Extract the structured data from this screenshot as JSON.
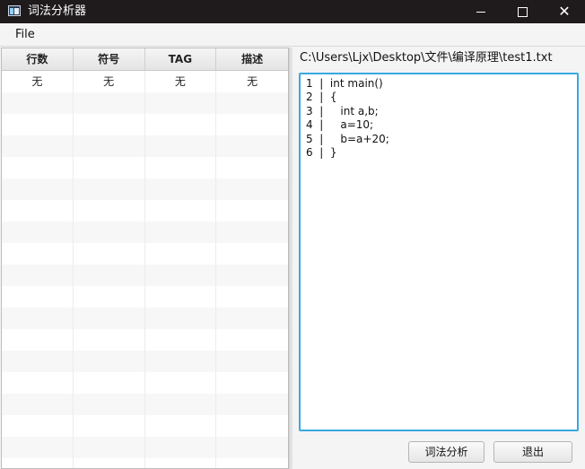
{
  "window": {
    "title": "词法分析器",
    "controls": {
      "minimize": "minimize-icon",
      "maximize": "maximize-icon",
      "close": "close-icon"
    }
  },
  "menubar": {
    "file": "File"
  },
  "table": {
    "columns": [
      "行数",
      "符号",
      "TAG",
      "描述"
    ],
    "rows": [
      [
        "无",
        "无",
        "无",
        "无"
      ],
      [
        "",
        "",
        "",
        ""
      ],
      [
        "",
        "",
        "",
        ""
      ],
      [
        "",
        "",
        "",
        ""
      ],
      [
        "",
        "",
        "",
        ""
      ],
      [
        "",
        "",
        "",
        ""
      ],
      [
        "",
        "",
        "",
        ""
      ],
      [
        "",
        "",
        "",
        ""
      ],
      [
        "",
        "",
        "",
        ""
      ],
      [
        "",
        "",
        "",
        ""
      ],
      [
        "",
        "",
        "",
        ""
      ],
      [
        "",
        "",
        "",
        ""
      ],
      [
        "",
        "",
        "",
        ""
      ],
      [
        "",
        "",
        "",
        ""
      ],
      [
        "",
        "",
        "",
        ""
      ],
      [
        "",
        "",
        "",
        ""
      ],
      [
        "",
        "",
        "",
        ""
      ],
      [
        "",
        "",
        "",
        ""
      ],
      [
        "",
        "",
        "",
        ""
      ]
    ]
  },
  "editor": {
    "path": "C:\\Users\\Ljx\\Desktop\\文件\\编译原理\\test1.txt",
    "code": "1  |  int main()\n2  |  {\n3  |     int a,b;\n4  |     a=10;\n5  |     b=a+20;\n6  |  }"
  },
  "buttons": {
    "analyze": "词法分析",
    "exit": "退出"
  },
  "colors": {
    "titlebar": "#1f1b1d",
    "editor_focus_border": "#39a8e0"
  }
}
